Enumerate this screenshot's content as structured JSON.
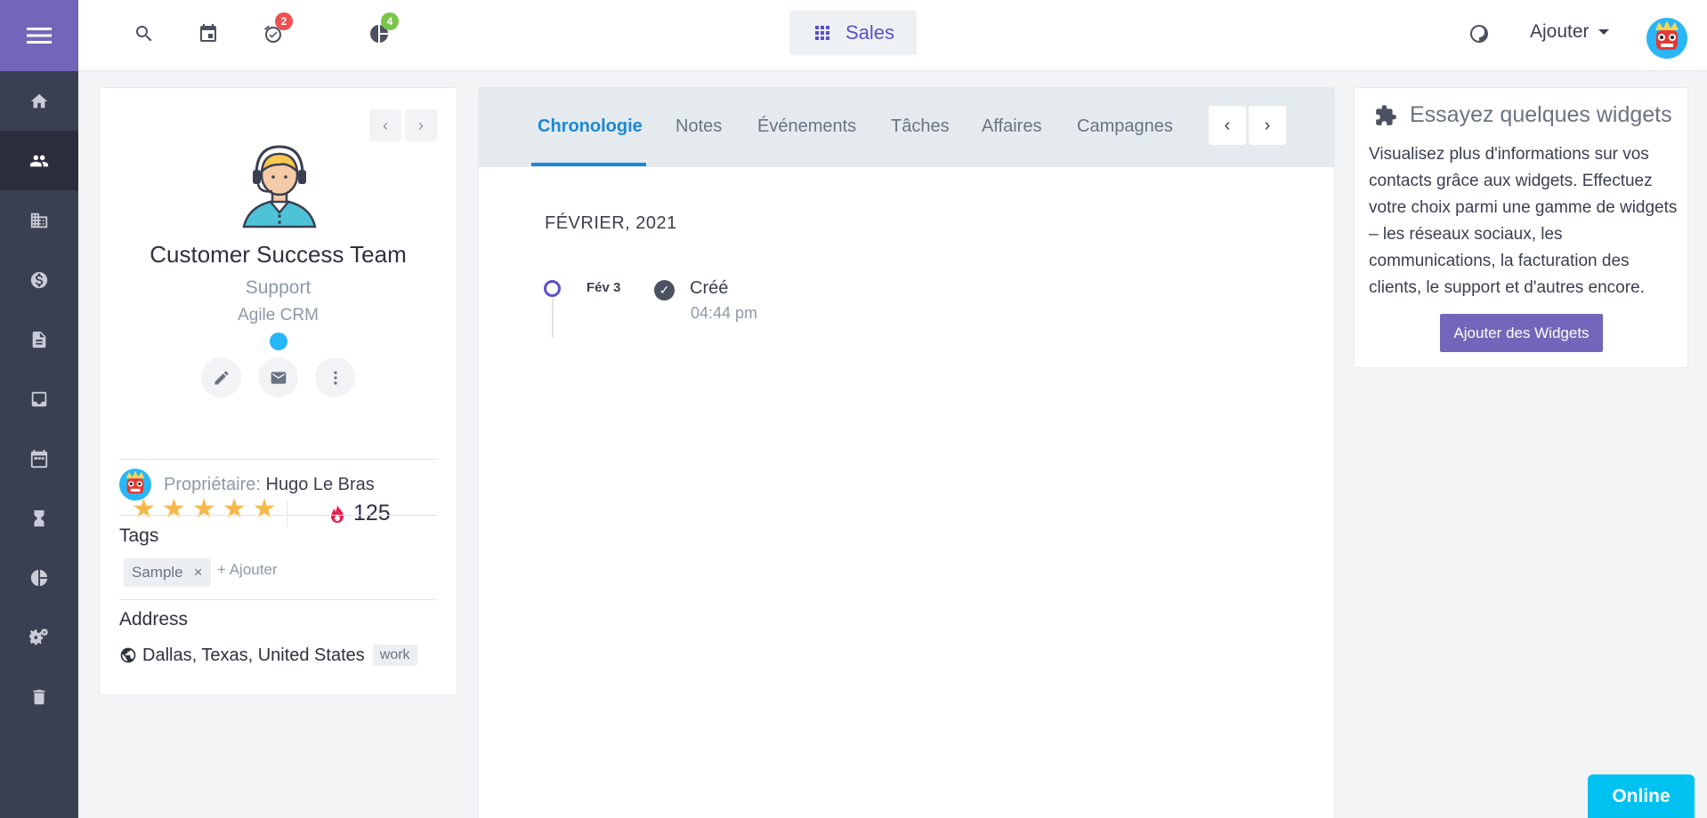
{
  "topbar": {
    "badges": {
      "reminders": "2",
      "reports": "4"
    },
    "app_switcher_label": "Sales",
    "add_menu_label": "Ajouter"
  },
  "sidebar": {
    "items": [
      {
        "icon": "home-icon"
      },
      {
        "icon": "contacts-icon",
        "active": true
      },
      {
        "icon": "companies-icon"
      },
      {
        "icon": "deals-icon"
      },
      {
        "icon": "documents-icon"
      },
      {
        "icon": "inbox-icon"
      },
      {
        "icon": "calendar-icon"
      },
      {
        "icon": "hourglass-icon"
      },
      {
        "icon": "reports-icon"
      },
      {
        "icon": "settings-icon"
      },
      {
        "icon": "trash-icon"
      }
    ]
  },
  "contact": {
    "name": "Customer Success Team",
    "title": "Support",
    "company": "Agile CRM",
    "star_rating": 5,
    "score": "125",
    "owner_label": "Propriétaire:",
    "owner_name": "Hugo Le Bras",
    "tags_title": "Tags",
    "tags": [
      "Sample"
    ],
    "tag_remove": "×",
    "tag_add_label": "+ Ajouter",
    "address_title": "Address",
    "address": "Dallas, Texas, United States",
    "address_type": "work"
  },
  "timeline": {
    "tabs": [
      "Chronologie",
      "Notes",
      "Événements",
      "Tâches",
      "Affaires",
      "Campagnes"
    ],
    "active_tab": "Chronologie",
    "month": "FÉVRIER, 2021",
    "events": [
      {
        "date": "Fév 3",
        "label": "Créé",
        "time": "04:44 pm"
      }
    ]
  },
  "widgets": {
    "title": "Essayez quelques widgets",
    "description": "Visualisez plus d'informations sur vos contacts grâce aux widgets. Effectuez votre choix parmi une gamme de widgets – les réseaux sociaux, les communications, la facturation des clients, le support et d'autres encore.",
    "button_label": "Ajouter des Widgets"
  },
  "chat": {
    "status_label": "Online"
  },
  "colors": {
    "sidebar_bg": "#3a3f51",
    "brand_purple": "#7266ba",
    "active_tab": "#1b88d4",
    "online": "#00c2f0",
    "star": "#f5b94b"
  }
}
